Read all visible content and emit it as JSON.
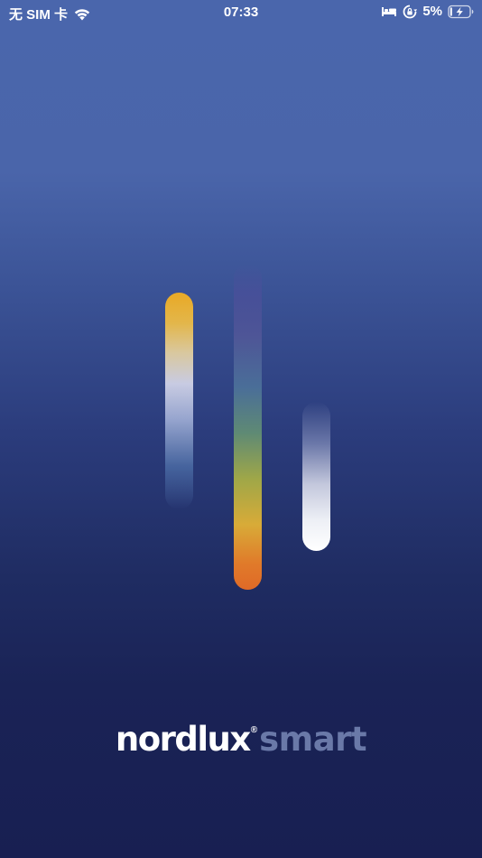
{
  "status_bar": {
    "carrier": "无 SIM 卡",
    "time": "07:33",
    "battery_percent": "5%",
    "icons": [
      "wifi-icon",
      "bed-icon",
      "orientation-lock-icon",
      "battery-charging-icon"
    ]
  },
  "splash": {
    "bars": [
      {
        "name": "left-light-bar",
        "colors": [
          "#e9a926",
          "#c8cbe2",
          "#46649e"
        ]
      },
      {
        "name": "middle-light-bar",
        "colors": [
          "#4e5597",
          "#5f8a74",
          "#d8ab38",
          "#df6a27"
        ]
      },
      {
        "name": "right-light-bar",
        "colors": [
          "#c3c7dc",
          "#ffffff"
        ]
      }
    ]
  },
  "logo": {
    "brand": "nordlux",
    "registered": "®",
    "product": "smart",
    "brand_color": "#ffffff",
    "product_color": "#6a79a8"
  },
  "colors": {
    "background_top": "#4a66ac",
    "background_bottom": "#181f52"
  }
}
